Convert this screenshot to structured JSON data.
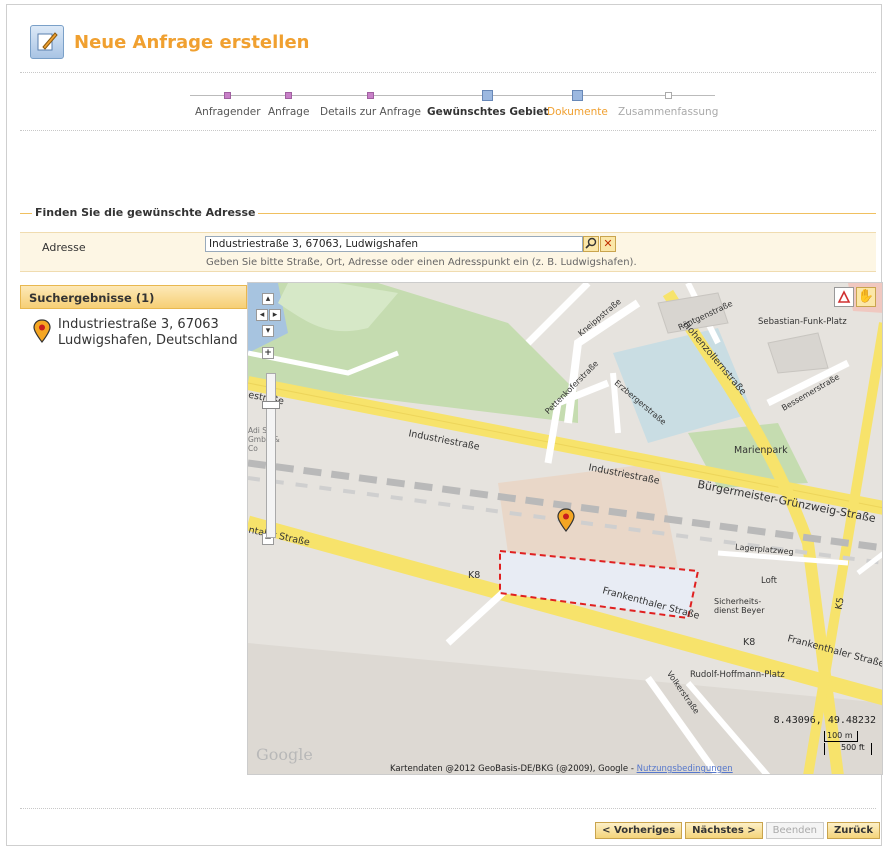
{
  "page": {
    "title": "Neue Anfrage erstellen"
  },
  "wizard": {
    "steps": [
      {
        "label": "Anfragender",
        "state": "done"
      },
      {
        "label": "Anfrage",
        "state": "done"
      },
      {
        "label": "Details zur Anfrage",
        "state": "done"
      },
      {
        "label": "Gewünschtes Gebiet",
        "state": "current"
      },
      {
        "label": "Dokumente",
        "state": "next"
      },
      {
        "label": "Zusammenfassung",
        "state": "pending"
      }
    ]
  },
  "address_section": {
    "legend": "Finden Sie die gewünschte Adresse",
    "label": "Adresse",
    "value": "Industriestraße 3, 67063, Ludwigshafen",
    "hint": "Geben Sie bitte Straße, Ort, Adresse oder einen Adresspunkt ein (z. B. Ludwigshafen).",
    "search_icon": "search-icon",
    "clear_icon": "close-icon"
  },
  "results": {
    "header": "Suchergebnisse (1)",
    "items": [
      {
        "line1": "Industriestraße 3, 67063",
        "line2": "Ludwigshafen, Deutschland",
        "icon": "map-pin-icon"
      }
    ]
  },
  "map": {
    "coords": "8.43096, 49.48232",
    "scale_metric": "100 m",
    "scale_imperial": "500 ft",
    "logo": "Google",
    "attribution": "Kartendaten @2012 GeoBasis-DE/BKG (@2009), Google - ",
    "terms_link": "Nutzungsbedingungen",
    "labels": {
      "industriestrasse_1": "Industriestraße",
      "industriestrasse_2": "Industriestraße",
      "buergermeister": "Bürgermeister-Grünzweig-Straße",
      "frankenthaler_1": "Frankenthaler Straße",
      "frankenthaler_2": "Frankenthaler Straße",
      "hohenzollern": "Hohenzollernstraße",
      "marienpark": "Marienpark",
      "sebastian": "Sebastian-Funk-Platz",
      "rudolf": "Rudolf-Hoffmann-Platz",
      "lagerplatz": "Lagerplatzweg",
      "loft": "Loft",
      "sicherheit": "Sicherheits-dienst Beyer",
      "k8_1": "K8",
      "k8_2": "K8",
      "k5": "K5",
      "kneipp": "Kneippstraße",
      "pettenkofer": "Pettenkoferstraße",
      "erzberger": "Erzbergerstraße",
      "roentgen": "Röntgenstraße",
      "bessemer": "Bessemerstraße",
      "volker": "Volkerstraße",
      "entaler": "ntaler Straße",
      "adi": "Adi S  d GmbH & Co",
      "estr": "estraße"
    },
    "selection_color": "#e02020",
    "accent_color": "#f0a030"
  },
  "footer": {
    "prev": "< Vorheriges",
    "next": "Nächstes >",
    "finish": "Beenden",
    "back": "Zurück"
  }
}
